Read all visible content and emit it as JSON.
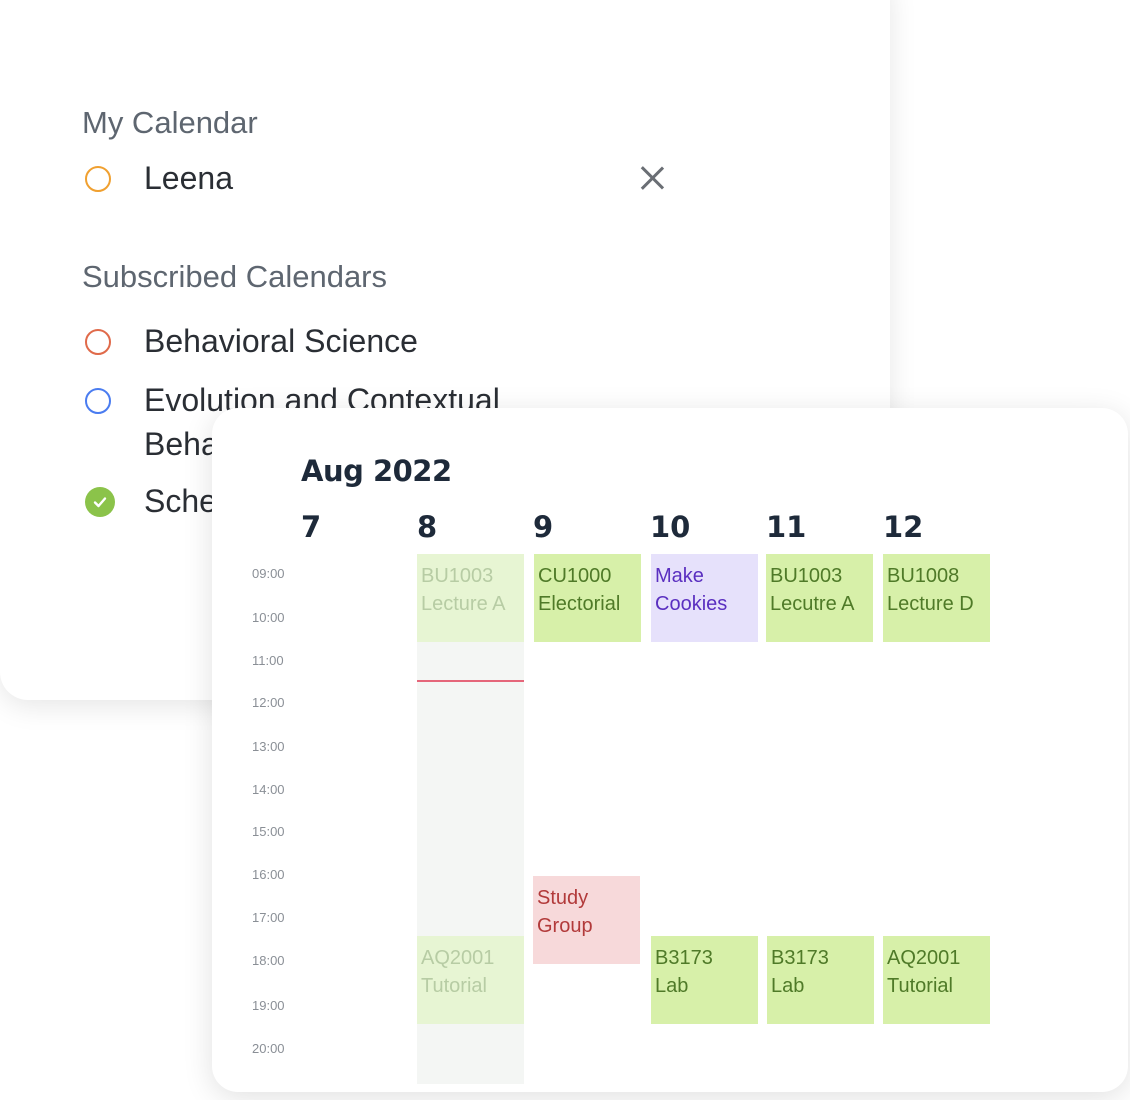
{
  "my_calendar": {
    "title": "My Calendar",
    "items": [
      {
        "label": "Leena",
        "color": "#f0a030"
      }
    ]
  },
  "subscribed": {
    "title": "Subscribed Calendars",
    "items": [
      {
        "label": "Behavioral Science",
        "color": "#e06a4a"
      },
      {
        "label": "Evolution and Contextual",
        "label2": "Beha",
        "color": "#4a7cf0"
      },
      {
        "label": "Sche",
        "color": "#8bc34a",
        "checked": true
      }
    ]
  },
  "week": {
    "month": "Aug 2022",
    "days": [
      "7",
      "8",
      "9",
      "10",
      "11",
      "12"
    ],
    "times": [
      "09:00",
      "10:00",
      "11:00",
      "12:00",
      "13:00",
      "14:00",
      "15:00",
      "16:00",
      "17:00",
      "18:00",
      "19:00",
      "20:00"
    ],
    "events": [
      {
        "day": "8",
        "line1": "BU1003",
        "line2": "Lecture A",
        "style": "past"
      },
      {
        "day": "9",
        "line1": "CU1000",
        "line2": "Electorial",
        "style": "green"
      },
      {
        "day": "10",
        "line1": "Make",
        "line2": "Cookies",
        "style": "purple"
      },
      {
        "day": "11",
        "line1": "BU1003",
        "line2": "Lecutre A",
        "style": "green"
      },
      {
        "day": "12",
        "line1": "BU1008",
        "line2": "Lecture D",
        "style": "green"
      },
      {
        "day": "9",
        "line1": "Study",
        "line2": "Group",
        "style": "red"
      },
      {
        "day": "8",
        "line1": "AQ2001",
        "line2": "Tutorial",
        "style": "past"
      },
      {
        "day": "10",
        "line1": "B3173",
        "line2": "Lab",
        "style": "green"
      },
      {
        "day": "11",
        "line1": "B3173",
        "line2": "Lab",
        "style": "green"
      },
      {
        "day": "12",
        "line1": "AQ2001",
        "line2": "Tutorial",
        "style": "green"
      }
    ]
  },
  "icons": {
    "close": "close-icon",
    "check": "check-icon"
  }
}
